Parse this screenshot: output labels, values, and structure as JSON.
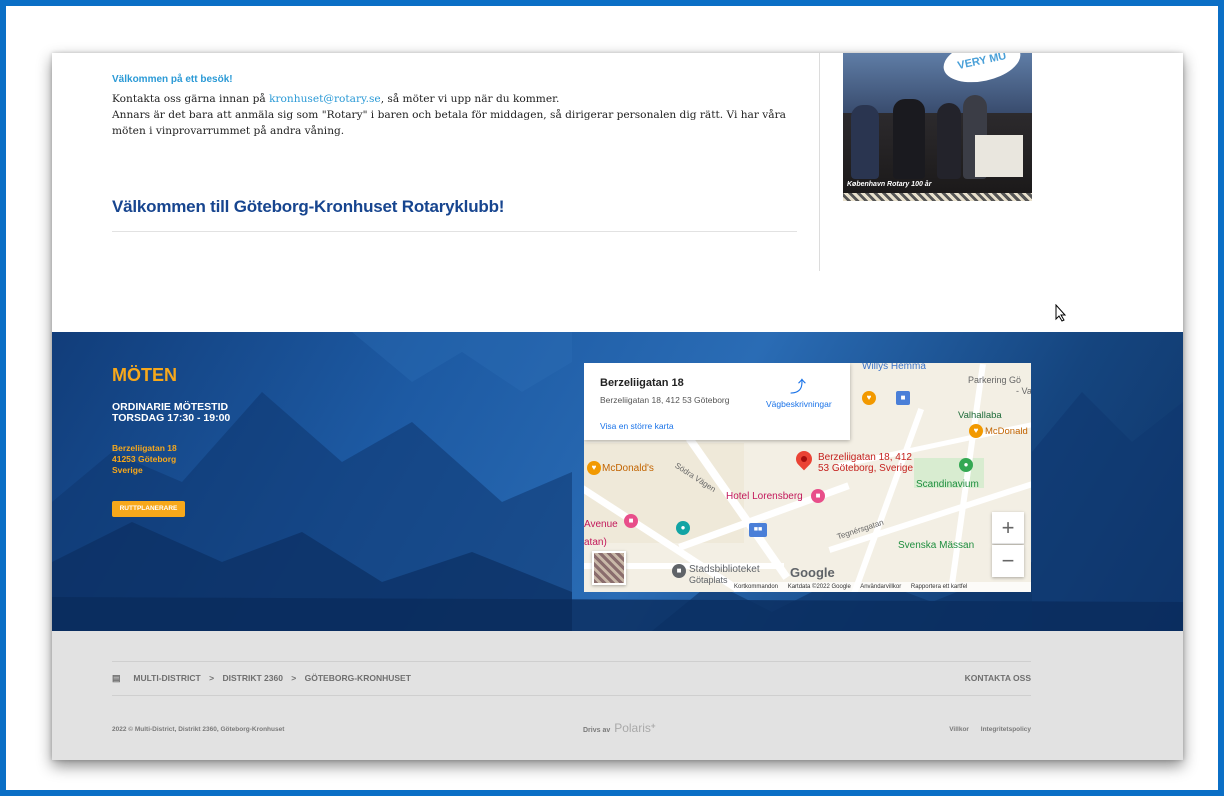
{
  "content": {
    "welcome_heading": "Välkommen på ett besök!",
    "line1_prefix": "Kontakta oss gärna innan på ",
    "email": "kronhuset@rotary.se",
    "line1_suffix": ", så möter vi upp när du kommer.",
    "line2": "Annars är det bara att anmäla sig som \"Rotary\" i baren och betala för middagen, så dirigerar personalen dig rätt. Vi har våra möten i vinprovarrummet på andra våning.",
    "club_title": "Välkommen till Göteborg-Kronhuset Rotaryklubb!",
    "photo": {
      "sign": "VERY MU",
      "caption": "København Rotary 100 år"
    }
  },
  "meetings": {
    "title": "MÖTEN",
    "time_line1": "ORDINARIE MÖTESTID",
    "time_line2": "TORSDAG 17:30 - 19:00",
    "addr1": "Berzeliigatan 18",
    "addr2": "41253 Göteborg",
    "addr3": "Sverige",
    "route_button": "RUTTPLANERARE"
  },
  "map": {
    "info_name": "Berzeliigatan 18",
    "info_addr": "Berzeliigatan 18, 412 53 Göteborg",
    "info_link": "Visa en större karta",
    "directions": "Vägbeskrivningar",
    "pin_label_1": "Berzeliigatan 18, 412",
    "pin_label_2": "53 Göteborg, Sverige",
    "labels": {
      "willys": "Willys Hemma",
      "parkering": "Parkering Gö",
      "parkering2": "- Va",
      "valhallab": "Valhallaba",
      "mcdonalds_right": "McDonald",
      "mcdonalds_left": "McDonald's",
      "sodra_vagen": "Södra Vägen",
      "hotel": "Hotel Lorensberg",
      "scandinavium": "Scandinavium",
      "avenue": "Avenue",
      "atan": "atan)",
      "tegnersgatan": "Tegnérsgatan",
      "svenska_massan": "Svenska Mässan",
      "stads1": "Stadsbiblioteket",
      "stads2": "Götaplats",
      "google": "Google"
    },
    "footer": [
      "Kortkommandon",
      "Kartdata ©2022 Google",
      "Användarvillkor",
      "Rapportera ett kartfel"
    ],
    "zoom_in": "+",
    "zoom_out": "−"
  },
  "footer": {
    "crumbs": [
      "MULTI-DISTRICT",
      "DISTRIKT 2360",
      "GÖTEBORG-KRONHUSET"
    ],
    "crumb_sep": ">",
    "contact": "KONTAKTA OSS",
    "copyright": "2022 © Multi-District, Distrikt 2360, Göteborg-Kronhuset",
    "powered_prefix": "Drivs av",
    "powered_brand": "Polaris",
    "powered_mark": "+",
    "terms": "Villkor",
    "privacy": "Integritetspolicy"
  },
  "colors": {
    "accent_blue": "#2b9ad6",
    "navy": "#17458f",
    "gold": "#f7a81b",
    "frame": "#0b6fc6"
  }
}
